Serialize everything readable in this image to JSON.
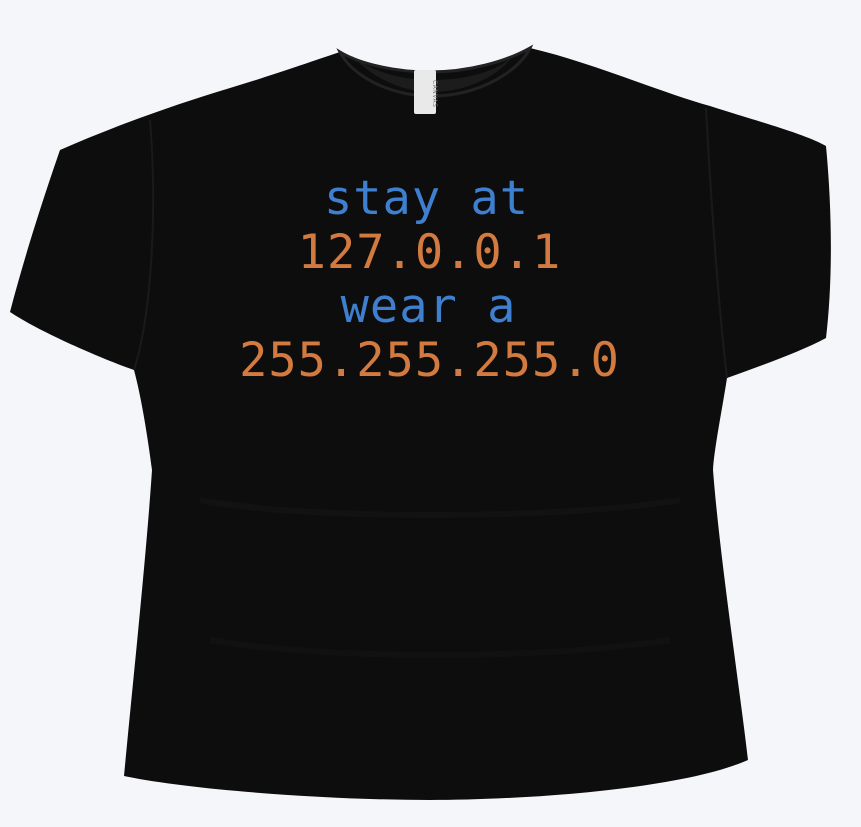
{
  "product": {
    "garment": "t-shirt",
    "shirt_color": "#0d0d0d",
    "background_color": "#f4f6fa"
  },
  "label_tag": {
    "text": "CANVAS"
  },
  "print_lines": [
    {
      "text": "stay at",
      "color": "#3f7fcf"
    },
    {
      "text": "127.0.0.1",
      "color": "#d27a3f"
    },
    {
      "text": "wear a",
      "color": "#3f7fcf"
    },
    {
      "text": "255.255.255.0",
      "color": "#d27a3f"
    }
  ]
}
